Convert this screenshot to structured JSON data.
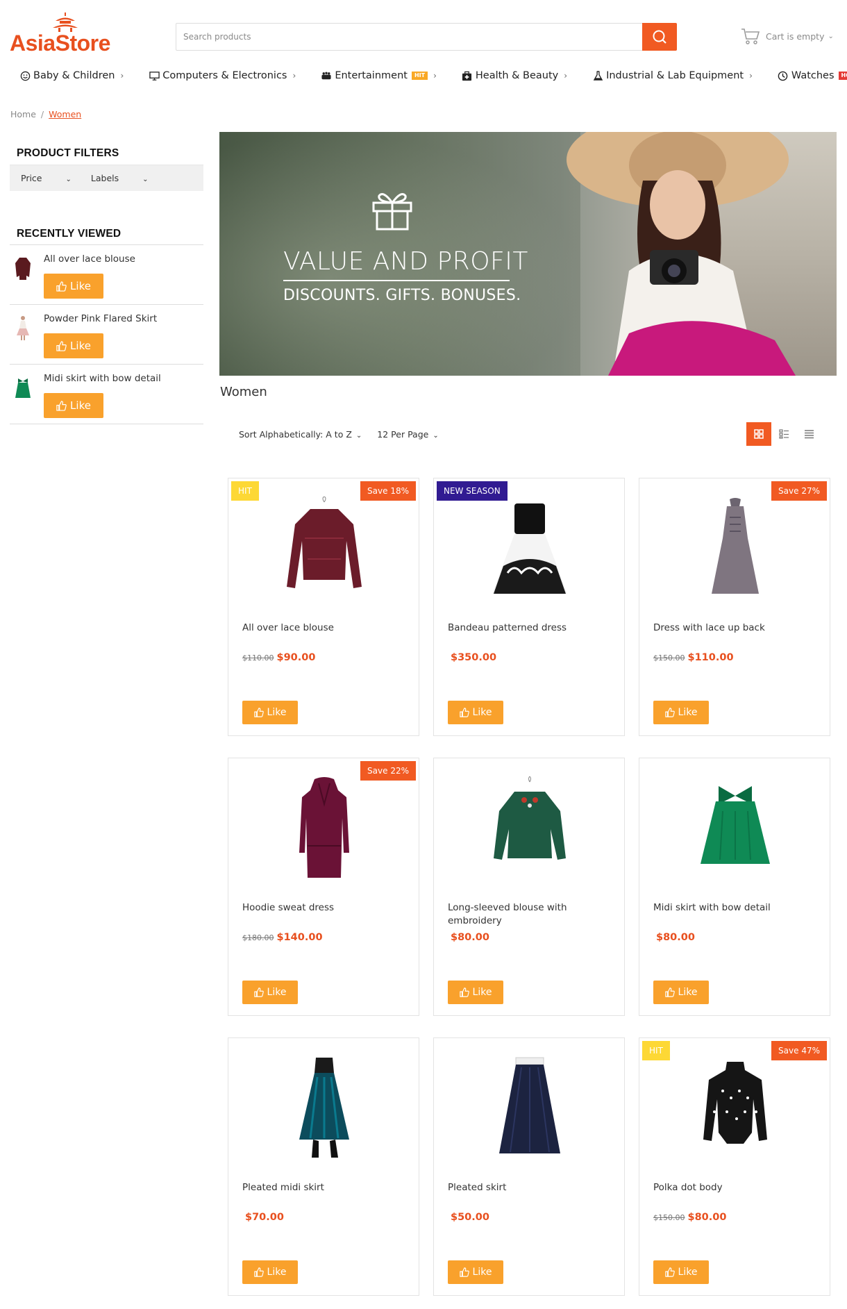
{
  "store": {
    "name_part1": "Asia",
    "name_part2": "Store"
  },
  "search": {
    "placeholder": "Search products"
  },
  "cart": {
    "label": "Cart is empty"
  },
  "nav": [
    {
      "label": "Baby & Children",
      "icon": "smile-icon",
      "tag": ""
    },
    {
      "label": "Computers & Electronics",
      "icon": "monitor-icon",
      "tag": ""
    },
    {
      "label": "Entertainment",
      "icon": "gamepad-icon",
      "tag": "HIT"
    },
    {
      "label": "Health & Beauty",
      "icon": "medkit-icon",
      "tag": ""
    },
    {
      "label": "Industrial & Lab Equipment",
      "icon": "flask-icon",
      "tag": ""
    },
    {
      "label": "Watches",
      "icon": "clock-icon",
      "tag": "HOT"
    }
  ],
  "breadcrumb": {
    "home": "Home",
    "separator": "/",
    "current": "Women"
  },
  "sidebar": {
    "filters_title": "PRODUCT FILTERS",
    "filters": [
      "Price",
      "Labels"
    ],
    "recent_title": "RECENTLY VIEWED",
    "recent": [
      {
        "name": "All over lace blouse",
        "like": "Like",
        "color": "#5a1a1f"
      },
      {
        "name": "Powder Pink Flared Skirt",
        "like": "Like",
        "color": "#e6b8b4"
      },
      {
        "name": "Midi skirt with bow detail",
        "like": "Like",
        "color": "#0f8a55"
      }
    ]
  },
  "banner": {
    "title": "VALUE AND PROFIT",
    "subtitle": "DISCOUNTS. GIFTS. BONUSES."
  },
  "category_title": "Women",
  "toolbar": {
    "sort": "Sort Alphabetically: A to Z",
    "per_page": "12 Per Page"
  },
  "products": [
    {
      "name": "All over lace blouse",
      "old_price": "$110.00",
      "price": "$90.00",
      "badge_left": "HIT",
      "badge_right": "Save 18%",
      "like": "Like",
      "color": "#6b1c2a"
    },
    {
      "name": "Bandeau patterned dress",
      "old_price": "",
      "price": "$350.00",
      "badge_left": "NEW SEASON",
      "badge_right": "",
      "like": "Like",
      "color": "#111111"
    },
    {
      "name": "Dress with lace up back",
      "old_price": "$150.00",
      "price": "$110.00",
      "badge_left": "",
      "badge_right": "Save 27%",
      "like": "Like",
      "color": "#7f7580"
    },
    {
      "name": "Hoodie sweat dress",
      "old_price": "$180.00",
      "price": "$140.00",
      "badge_left": "",
      "badge_right": "Save 22%",
      "like": "Like",
      "color": "#6a1236"
    },
    {
      "name": "Long-sleeved blouse with embroidery",
      "old_price": "",
      "price": "$80.00",
      "badge_left": "",
      "badge_right": "",
      "like": "Like",
      "color": "#1e5a43"
    },
    {
      "name": "Midi skirt with bow detail",
      "old_price": "",
      "price": "$80.00",
      "badge_left": "",
      "badge_right": "",
      "like": "Like",
      "color": "#0f8a55"
    },
    {
      "name": "Pleated midi skirt",
      "old_price": "",
      "price": "$70.00",
      "badge_left": "",
      "badge_right": "",
      "like": "Like",
      "color": "#0c4c5c"
    },
    {
      "name": "Pleated skirt",
      "old_price": "",
      "price": "$50.00",
      "badge_left": "",
      "badge_right": "",
      "like": "Like",
      "color": "#1c2340"
    },
    {
      "name": "Polka dot body",
      "old_price": "$150.00",
      "price": "$80.00",
      "badge_left": "HIT",
      "badge_right": "Save 47%",
      "like": "Like",
      "color": "#151515"
    }
  ],
  "colors": {
    "accent": "#f15a22",
    "like": "#f9a12c",
    "price": "#e8501f",
    "hit": "#fdd835",
    "new_season": "#311b92"
  }
}
